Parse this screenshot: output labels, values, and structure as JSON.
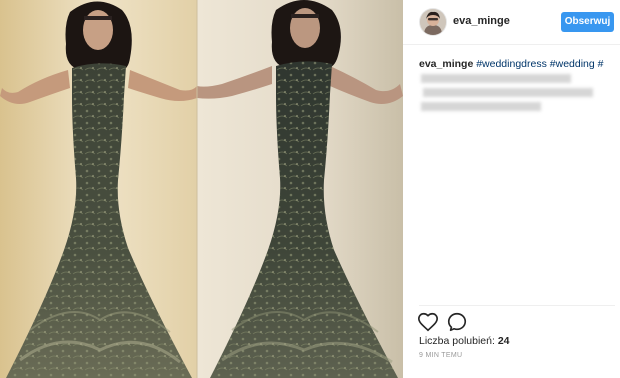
{
  "post": {
    "username": "eva_minge",
    "follow_label": "Obserwuj",
    "caption": {
      "author": "eva_minge",
      "hashtags": [
        "#weddingdress",
        "#wedding",
        "#"
      ]
    },
    "likes_label": "Liczba polubień:",
    "likes_count": "24",
    "timestamp": "9 MIN TEMU"
  },
  "icons": [
    "heart-icon",
    "comment-icon"
  ],
  "colors": {
    "follow_button": "#3897f0",
    "hashtag": "#003569",
    "timestamp": "#999999",
    "divider": "#efefef"
  }
}
